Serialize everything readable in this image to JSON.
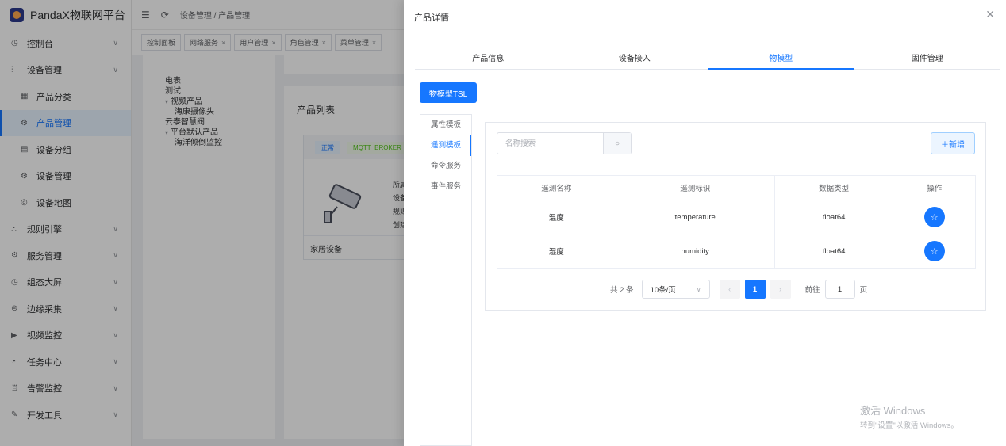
{
  "app": {
    "name": "PandaX物联网平台"
  },
  "sidebar": {
    "items": [
      {
        "label": "控制台",
        "icon": "clock-icon",
        "arrow": true
      },
      {
        "label": "设备管理",
        "icon": "device-icon",
        "arrow": true
      },
      {
        "label": "产品分类",
        "icon": "grid-icon",
        "sub": true
      },
      {
        "label": "产品管理",
        "icon": "gear-icon",
        "sub": true,
        "active": true
      },
      {
        "label": "设备分组",
        "icon": "list-icon",
        "sub": true
      },
      {
        "label": "设备管理",
        "icon": "setting-icon",
        "sub": true
      },
      {
        "label": "设备地图",
        "icon": "map-icon",
        "sub": true
      },
      {
        "label": "规则引擎",
        "icon": "flow-icon",
        "arrow": true
      },
      {
        "label": "服务管理",
        "icon": "service-icon",
        "arrow": true
      },
      {
        "label": "组态大屏",
        "icon": "screen-icon",
        "arrow": true
      },
      {
        "label": "边缘采集",
        "icon": "edge-icon",
        "arrow": true
      },
      {
        "label": "视频监控",
        "icon": "video-icon",
        "arrow": true
      },
      {
        "label": "任务中心",
        "icon": "task-icon",
        "arrow": true
      },
      {
        "label": "告警监控",
        "icon": "alarm-icon",
        "arrow": true
      },
      {
        "label": "开发工具",
        "icon": "tool-icon",
        "arrow": true
      }
    ]
  },
  "topbar": {
    "breadcrumb": "设备管理 / 产品管理"
  },
  "tags": [
    {
      "label": "控制面板",
      "closable": false
    },
    {
      "label": "网络服务",
      "closable": true
    },
    {
      "label": "用户管理",
      "closable": true
    },
    {
      "label": "角色管理",
      "closable": true
    },
    {
      "label": "菜单管理",
      "closable": true
    }
  ],
  "tree": [
    {
      "label": "电表",
      "level": 1
    },
    {
      "label": "测试",
      "level": 1
    },
    {
      "label": "视频产品",
      "level": 1,
      "caret": true
    },
    {
      "label": "海康摄像头",
      "level": 2
    },
    {
      "label": "云泰智慧阀",
      "level": 1
    },
    {
      "label": "平台默认产品",
      "level": 1,
      "caret": true
    },
    {
      "label": "海洋倾倒监控",
      "level": 2
    }
  ],
  "product_list": {
    "title": "产品列表",
    "card": {
      "status": "正常",
      "protocol": "MQTT_BROKER",
      "meta": [
        "所属",
        "设备",
        "规则",
        "创建"
      ],
      "name": "家居设备"
    }
  },
  "drawer": {
    "title": "产品详情",
    "close_icon": "✕",
    "tabs": [
      {
        "label": "产品信息",
        "active": false
      },
      {
        "label": "设备接入",
        "active": false
      },
      {
        "label": "物模型",
        "active": true
      },
      {
        "label": "固件管理",
        "active": false
      }
    ],
    "tsl_button": "物模型TSL",
    "side_tabs": [
      {
        "label": "属性模板",
        "active": false
      },
      {
        "label": "遥测模板",
        "active": true
      },
      {
        "label": "命令服务",
        "active": false
      },
      {
        "label": "事件服务",
        "active": false
      }
    ],
    "search": {
      "placeholder": "名称搜索",
      "value": ""
    },
    "add_button": "＋新增",
    "table": {
      "columns": [
        "遥测名称",
        "遥测标识",
        "数据类型",
        "操作"
      ],
      "rows": [
        {
          "name": "温度",
          "key": "temperature",
          "type": "float64"
        },
        {
          "name": "湿度",
          "key": "humidity",
          "type": "float64"
        }
      ]
    },
    "pagination": {
      "total": "共 2 条",
      "page_size": "10条/页",
      "current_page": "1",
      "goto_label": "前往",
      "goto_value": "1",
      "page_suffix": "页"
    }
  },
  "watermark": {
    "line1": "激活 Windows",
    "line2": "转到\"设置\"以激活 Windows。"
  },
  "colors": {
    "primary": "#1677ff",
    "mask": "rgba(0,0,0,0.32)"
  }
}
